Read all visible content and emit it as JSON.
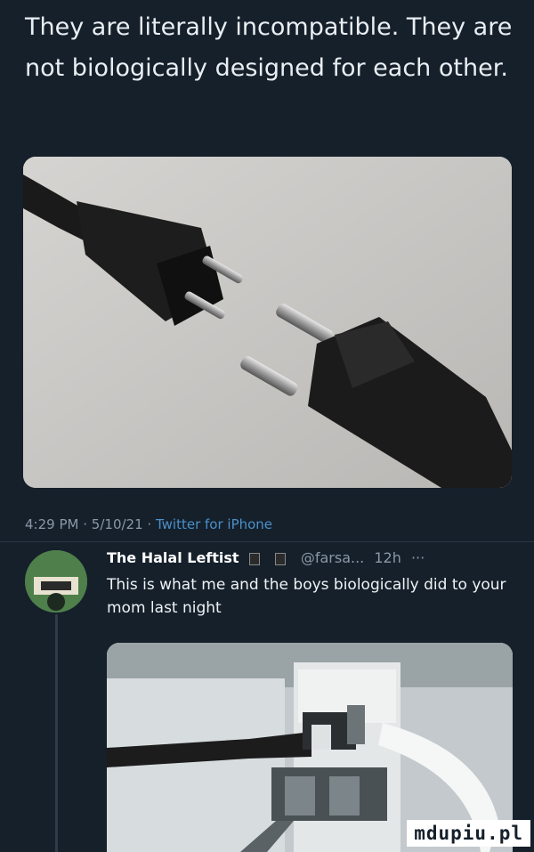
{
  "tweet": {
    "text": "They are literally incompatible. They are not biologically designed for each other."
  },
  "meta": {
    "time": "4:29 PM",
    "separator": "·",
    "date": "5/10/21",
    "client": "Twitter for iPhone"
  },
  "reply": {
    "name": "The Halal Leftist",
    "handle": "@farsa...",
    "age": "12h",
    "more": "···",
    "text": "This is what me and the boys biologically did to your mom last night"
  },
  "watermark": "mdupiu.pl",
  "colors": {
    "background": "#15202b",
    "meta_text": "#8b98a5",
    "client_link": "#4a90c9"
  }
}
